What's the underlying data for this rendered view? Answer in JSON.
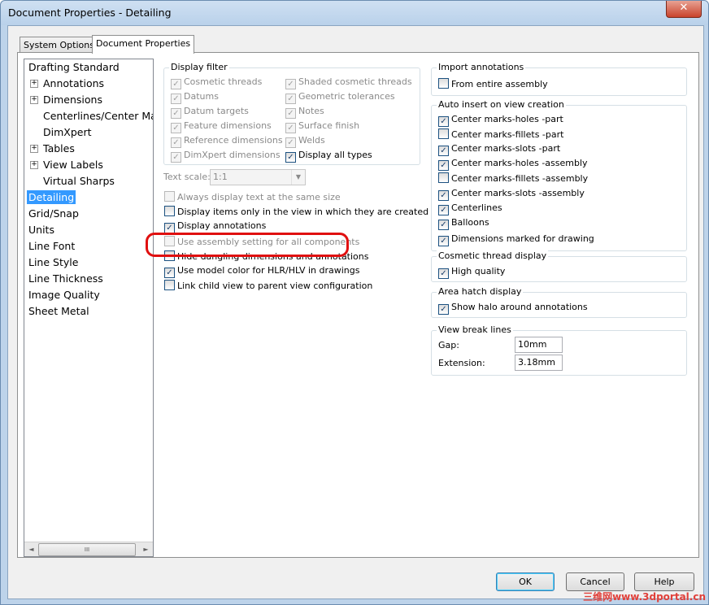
{
  "window": {
    "title": "Document Properties - Detailing",
    "close_glyph": "✕"
  },
  "tabs": [
    {
      "label": "System Options"
    },
    {
      "label": "Document Properties"
    }
  ],
  "tree": {
    "items": [
      {
        "label": "Drafting Standard"
      },
      {
        "label": "Annotations"
      },
      {
        "label": "Dimensions"
      },
      {
        "label": "Centerlines/Center Mar"
      },
      {
        "label": "DimXpert"
      },
      {
        "label": "Tables"
      },
      {
        "label": "View Labels"
      },
      {
        "label": "Virtual Sharps"
      },
      {
        "label": "Detailing"
      },
      {
        "label": "Grid/Snap"
      },
      {
        "label": "Units"
      },
      {
        "label": "Line Font"
      },
      {
        "label": "Line Style"
      },
      {
        "label": "Line Thickness"
      },
      {
        "label": "Image Quality"
      },
      {
        "label": "Sheet Metal"
      }
    ],
    "selected": "Detailing",
    "scroll_left": "◄",
    "scroll_right": "►",
    "grip": "III"
  },
  "display_filter": {
    "title": "Display filter",
    "items": [
      {
        "label": "Cosmetic threads",
        "checked": true,
        "disabled": true
      },
      {
        "label": "Datums",
        "checked": true,
        "disabled": true
      },
      {
        "label": "Datum targets",
        "checked": true,
        "disabled": true
      },
      {
        "label": "Feature dimensions",
        "checked": true,
        "disabled": true
      },
      {
        "label": "Reference dimensions",
        "checked": true,
        "disabled": true
      },
      {
        "label": "DimXpert dimensions",
        "checked": true,
        "disabled": true
      },
      {
        "label": "Shaded cosmetic threads",
        "checked": true,
        "disabled": true
      },
      {
        "label": "Geometric tolerances",
        "checked": true,
        "disabled": true
      },
      {
        "label": "Notes",
        "checked": true,
        "disabled": true
      },
      {
        "label": "Surface finish",
        "checked": true,
        "disabled": true
      },
      {
        "label": "Welds",
        "checked": true,
        "disabled": true
      },
      {
        "label": "Display all types",
        "checked": true,
        "disabled": false
      }
    ]
  },
  "text_scale": {
    "label": "Text scale:",
    "value": "1:1",
    "dropdown_glyph": "▼"
  },
  "options": [
    {
      "label": "Always display text at the same size",
      "checked": false,
      "disabled": true
    },
    {
      "label": "Display items only in the view in which they are created",
      "checked": false,
      "disabled": false
    },
    {
      "label": "Display annotations",
      "checked": true,
      "disabled": false
    },
    {
      "label": "Use assembly setting for all components",
      "checked": false,
      "disabled": true
    },
    {
      "label": "Hide dangling dimensions and annotations",
      "checked": false,
      "disabled": false
    },
    {
      "label": "Use model color for HLR/HLV in drawings",
      "checked": true,
      "disabled": false
    },
    {
      "label": "Link child view to parent view configuration",
      "checked": false,
      "disabled": false
    }
  ],
  "import_annotations": {
    "title": "Import annotations",
    "items": [
      {
        "label": "From entire assembly",
        "checked": false
      }
    ]
  },
  "auto_insert": {
    "title": "Auto insert on view creation",
    "items": [
      {
        "label": "Center marks-holes -part",
        "checked": true
      },
      {
        "label": "Center marks-fillets -part",
        "checked": false
      },
      {
        "label": "Center marks-slots  -part",
        "checked": true
      },
      {
        "label": "Center marks-holes -assembly",
        "checked": true
      },
      {
        "label": "Center marks-fillets -assembly",
        "checked": false
      },
      {
        "label": "Center marks-slots  -assembly",
        "checked": true
      },
      {
        "label": "Centerlines",
        "checked": true
      },
      {
        "label": "Balloons",
        "checked": true
      },
      {
        "label": "Dimensions marked for drawing",
        "checked": true
      }
    ]
  },
  "cosmetic_thread": {
    "title": "Cosmetic thread display",
    "items": [
      {
        "label": "High quality",
        "checked": true
      }
    ]
  },
  "area_hatch": {
    "title": "Area hatch display",
    "items": [
      {
        "label": "Show halo around annotations",
        "checked": true
      }
    ]
  },
  "view_break": {
    "title": "View break lines",
    "gap_label": "Gap:",
    "gap_value": "10mm",
    "extension_label": "Extension:",
    "extension_value": "3.18mm"
  },
  "buttons": {
    "ok": "OK",
    "cancel": "Cancel",
    "help": "Help"
  },
  "watermark": "三维网www.3dportal.cn",
  "check_glyph": "✓"
}
